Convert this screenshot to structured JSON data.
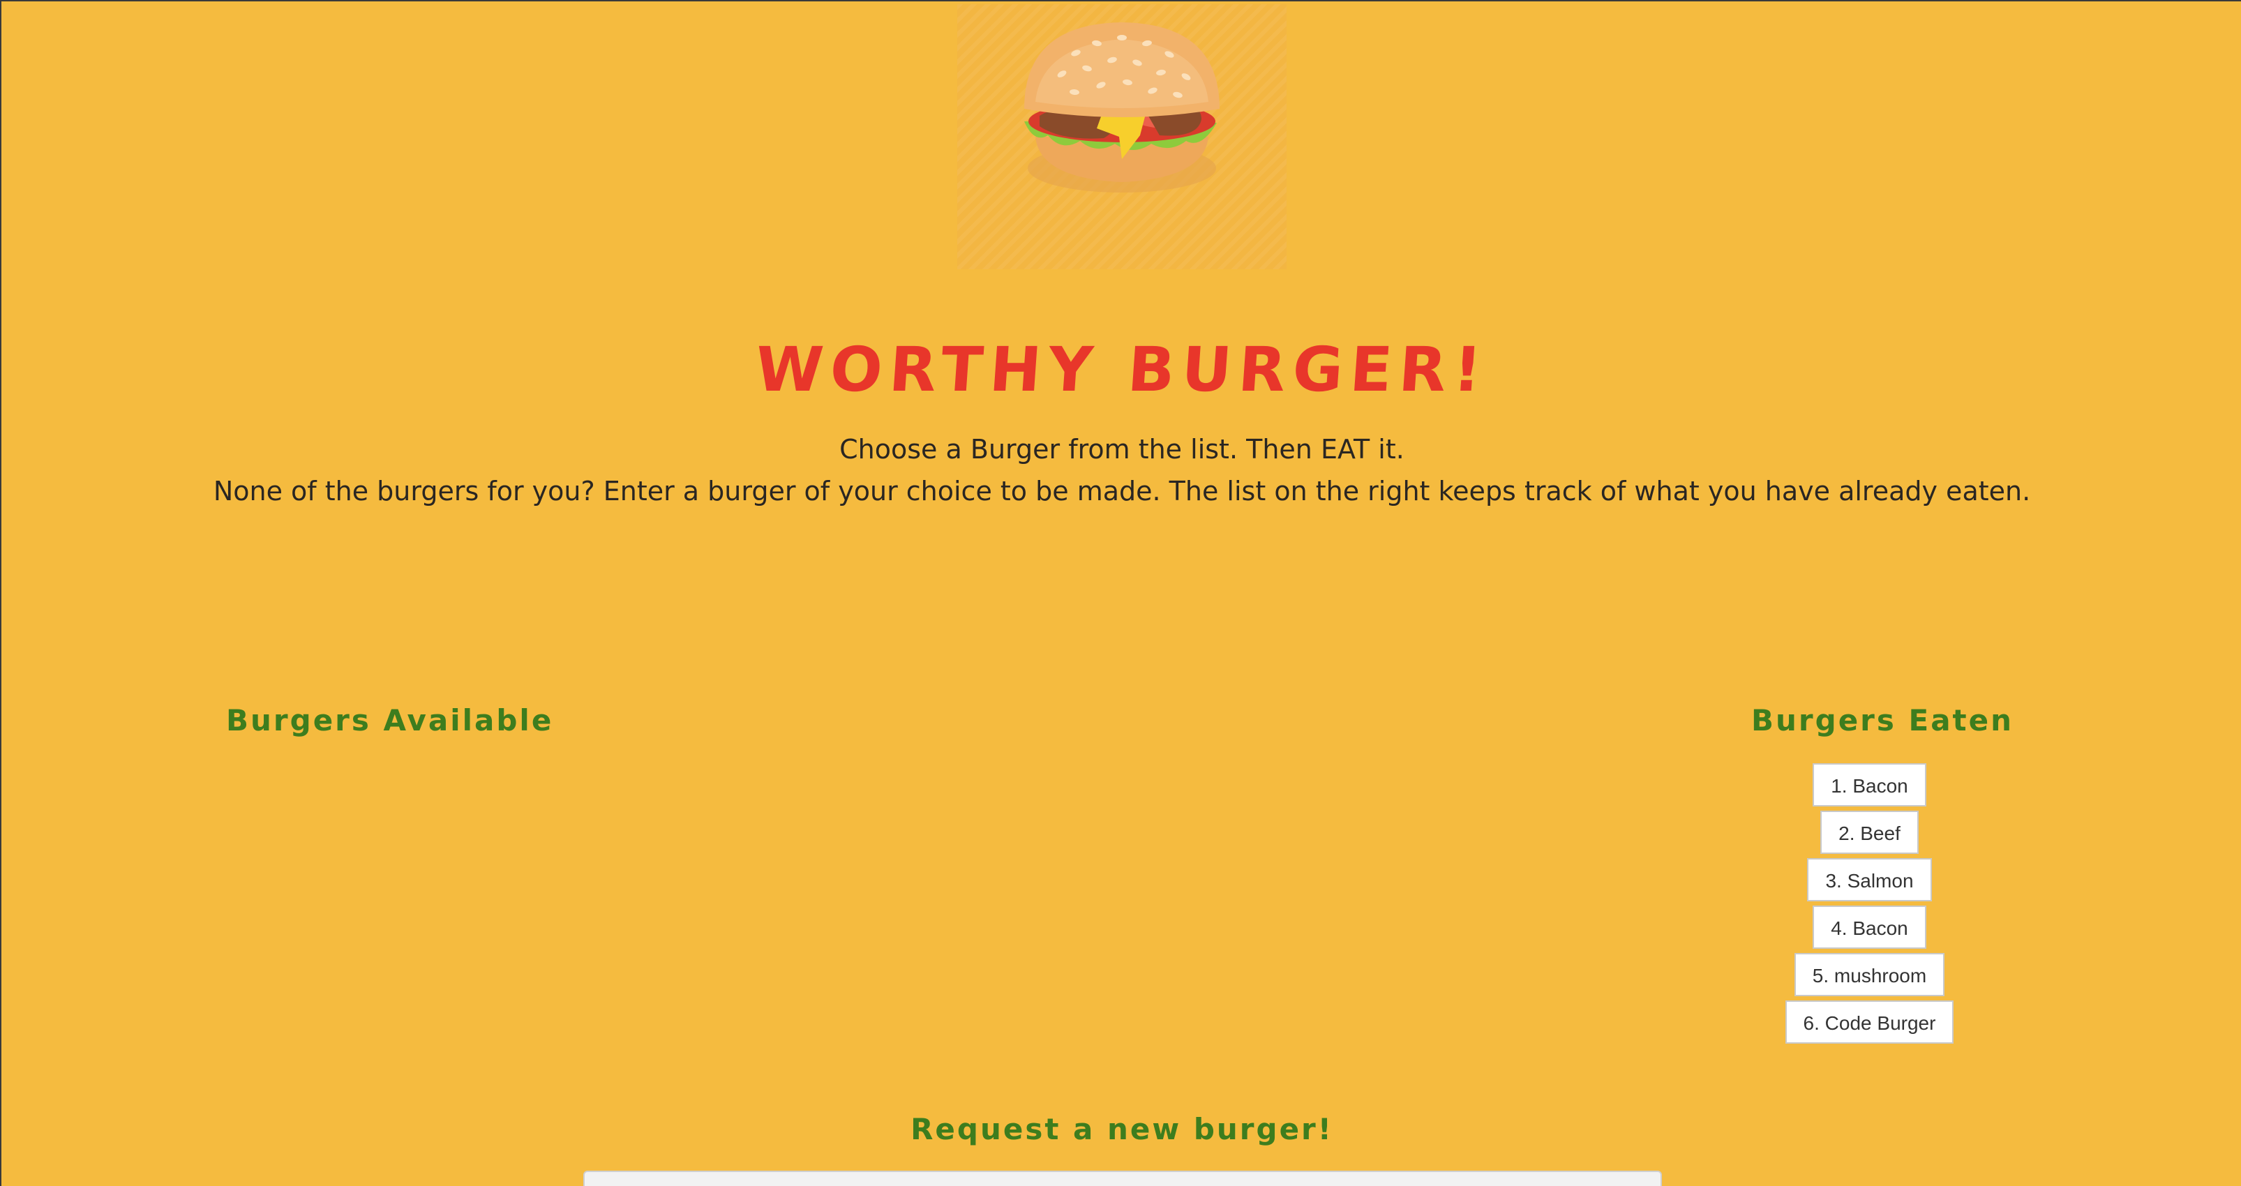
{
  "header": {
    "logo_icon": "burger-icon",
    "title": "WORTHY BURGER!",
    "tagline_line1": "Choose a Burger from the list. Then EAT it.",
    "tagline_line2": "None of the burgers for you? Enter a burger of your choice to be made. The list on the right keeps track of what you have already eaten."
  },
  "available": {
    "heading": "Burgers Available",
    "items": []
  },
  "eaten": {
    "heading": "Burgers Eaten",
    "items": [
      "1. Bacon",
      "2. Beef",
      "3. Salmon",
      "4. Bacon",
      "5. mushroom",
      "6. Code Burger"
    ]
  },
  "request": {
    "heading": "Request a new burger!",
    "input_value": ""
  },
  "colors": {
    "background": "#f5bb3f",
    "title": "#e8362a",
    "section_heading": "#3d7d1e",
    "text": "#2a2622"
  }
}
